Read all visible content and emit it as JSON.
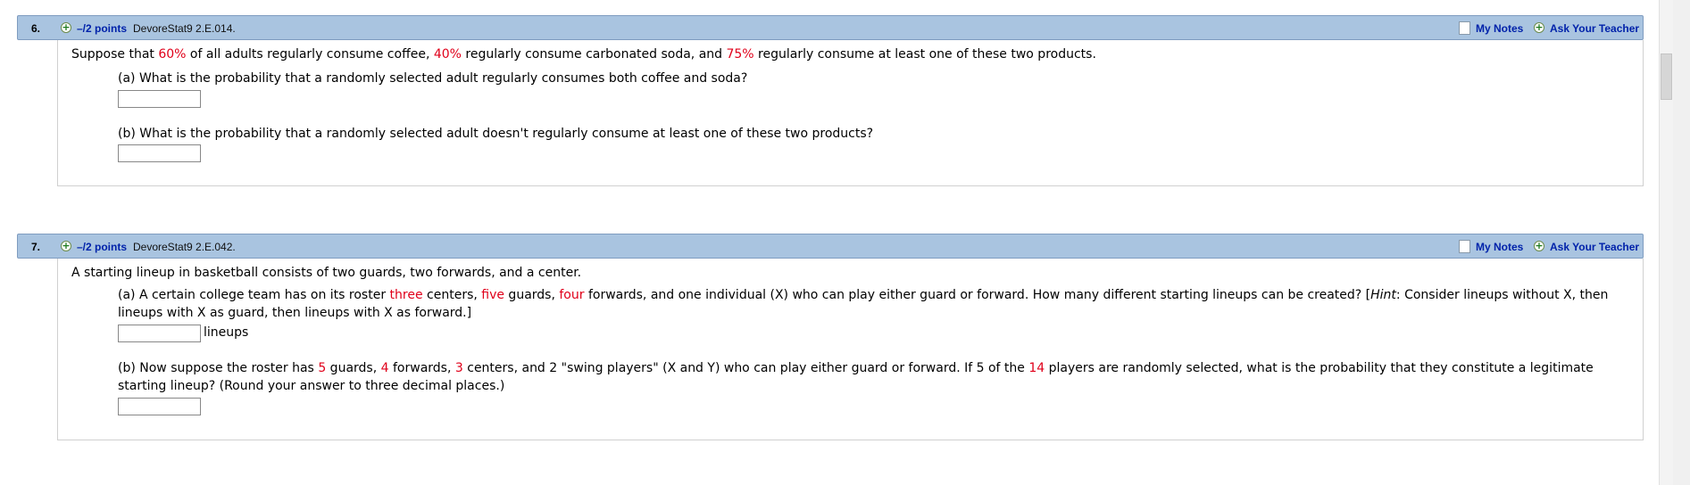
{
  "colors": {
    "header_bg": "#a9c4e0",
    "link": "#0022aa",
    "highlight": "#e0001a"
  },
  "questions": [
    {
      "number": "6.",
      "points": "–/2 points",
      "source": "DevoreStat9 2.E.014.",
      "my_notes": "My Notes",
      "ask_teacher": "Ask Your Teacher",
      "stem": {
        "t1": "Suppose that ",
        "v1": "60%",
        "t2": " of all adults regularly consume coffee, ",
        "v2": "40%",
        "t3": " regularly consume carbonated soda, and ",
        "v3": "75%",
        "t4": " regularly consume at least one of these two products."
      },
      "part_a": "(a) What is the probability that a randomly selected adult regularly consumes both coffee and soda?",
      "part_a_answer": "",
      "part_b": "(b) What is the probability that a randomly selected adult doesn't regularly consume at least one of these two products?",
      "part_b_answer": ""
    },
    {
      "number": "7.",
      "points": "–/2 points",
      "source": "DevoreStat9 2.E.042.",
      "my_notes": "My Notes",
      "ask_teacher": "Ask Your Teacher",
      "stem": "A starting lineup in basketball consists of two guards, two forwards, and a center.",
      "part_a": {
        "t1": "(a) A certain college team has on its roster ",
        "v1": "three",
        "t2": " centers, ",
        "v2": "five",
        "t3": " guards, ",
        "v3": "four",
        "t4": " forwards, and one individual (X) who can play either guard or forward. How many different starting lineups can be created? [",
        "hint": "Hint",
        "t5": ": Consider lineups without X, then lineups with X as guard, then lineups with X as forward.]"
      },
      "part_a_answer": "",
      "part_a_unit": "lineups",
      "part_b": {
        "t1": "(b) Now suppose the roster has ",
        "v1": "5",
        "t2": " guards, ",
        "v2": "4",
        "t3": " forwards, ",
        "v3": "3",
        "t4": " centers, and 2 \"swing players\" (X and Y) who can play either guard or forward. If 5 of the ",
        "v4": "14",
        "t5": " players are randomly selected, what is the probability that they constitute a legitimate starting lineup? (Round your answer to three decimal places.)"
      },
      "part_b_answer": ""
    }
  ]
}
